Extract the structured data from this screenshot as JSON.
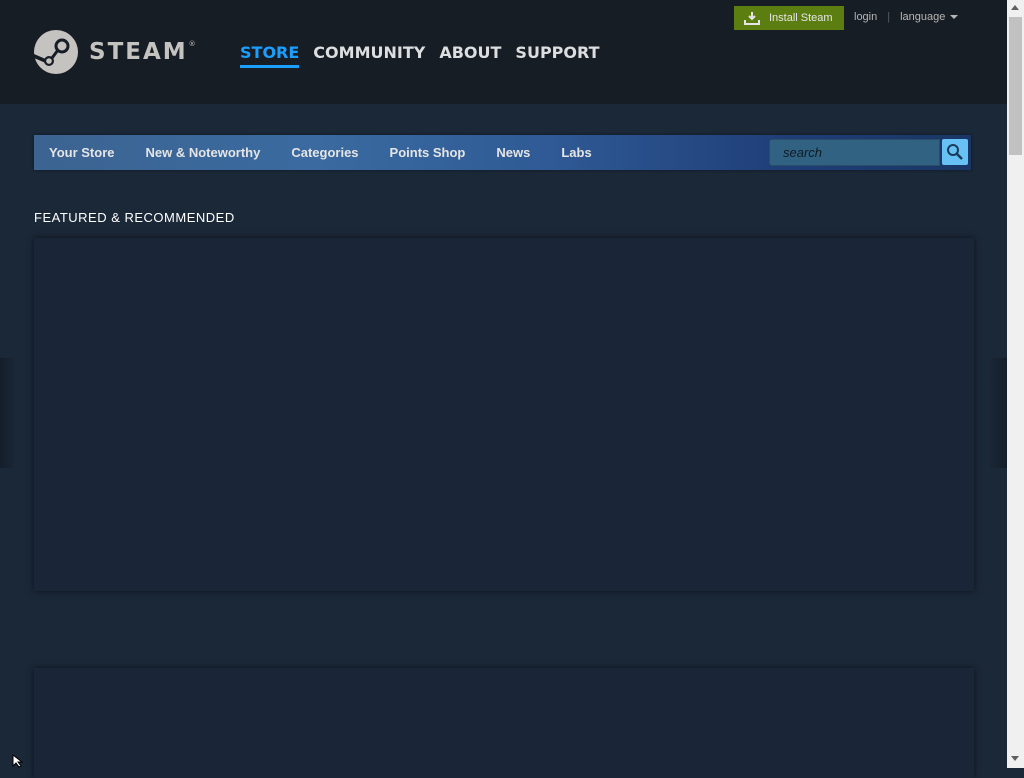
{
  "header": {
    "logo_text": "STEAM",
    "logo_registered": "®",
    "nav": [
      {
        "label": "STORE",
        "active": true
      },
      {
        "label": "COMMUNITY",
        "active": false
      },
      {
        "label": "ABOUT",
        "active": false
      },
      {
        "label": "SUPPORT",
        "active": false
      }
    ],
    "install_label": "Install Steam",
    "login_label": "login",
    "separator": "|",
    "language_label": "language"
  },
  "store_nav": {
    "items": [
      "Your Store",
      "New & Noteworthy",
      "Categories",
      "Points Shop",
      "News",
      "Labs"
    ],
    "search_placeholder": "search"
  },
  "content": {
    "section_title": "FEATURED & RECOMMENDED"
  },
  "colors": {
    "background": "#1b2838",
    "header_bg": "#171d25",
    "accent": "#1a9fff",
    "install_green": "#5c7e10",
    "search_button": "#67c1f5"
  },
  "icons": {
    "logo": "steam-logo-icon",
    "install": "download-icon",
    "language": "caret-down-icon",
    "search": "magnifier-icon"
  }
}
